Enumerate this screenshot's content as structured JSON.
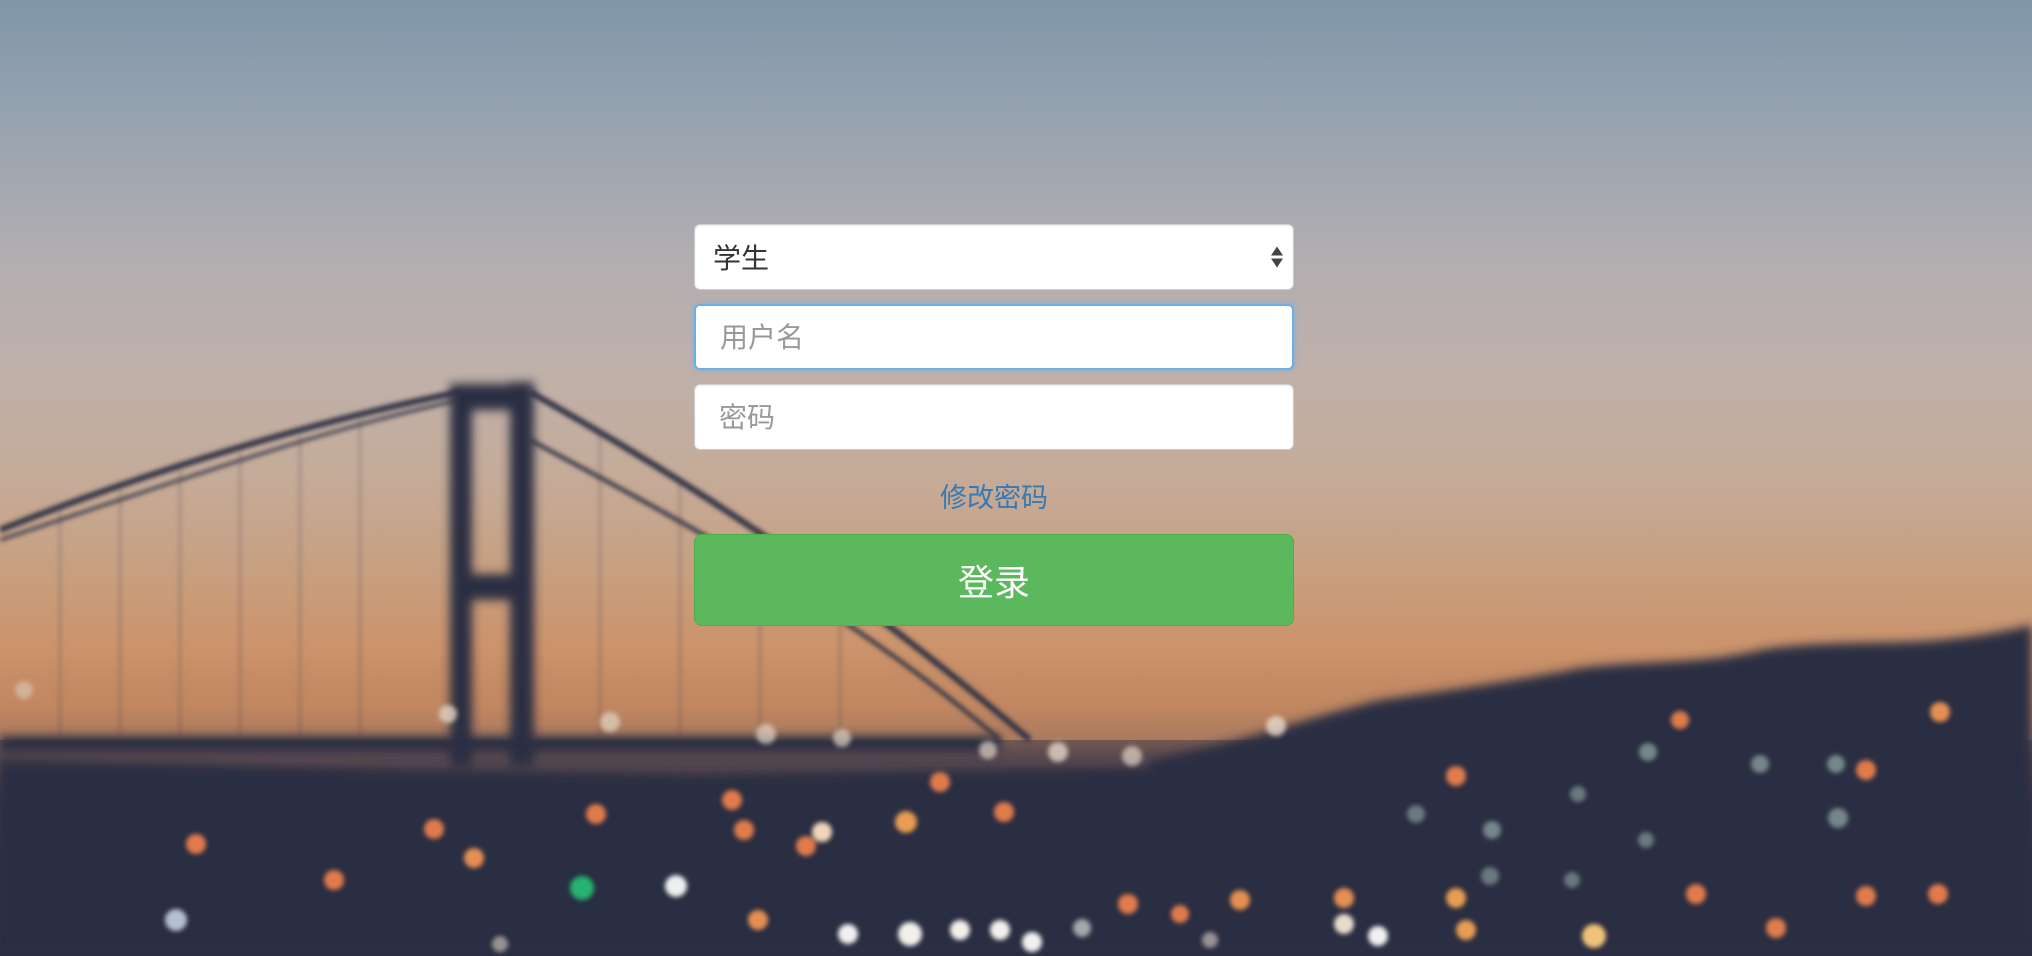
{
  "login_form": {
    "role_select": {
      "selected": "学生"
    },
    "username": {
      "placeholder": "用户名",
      "value": ""
    },
    "password": {
      "placeholder": "密码",
      "value": ""
    },
    "change_password_link": "修改密码",
    "login_button": "登录"
  },
  "colors": {
    "button_green": "#5cb85c",
    "link_blue": "#337ab7",
    "focus_border": "#66afe9"
  }
}
